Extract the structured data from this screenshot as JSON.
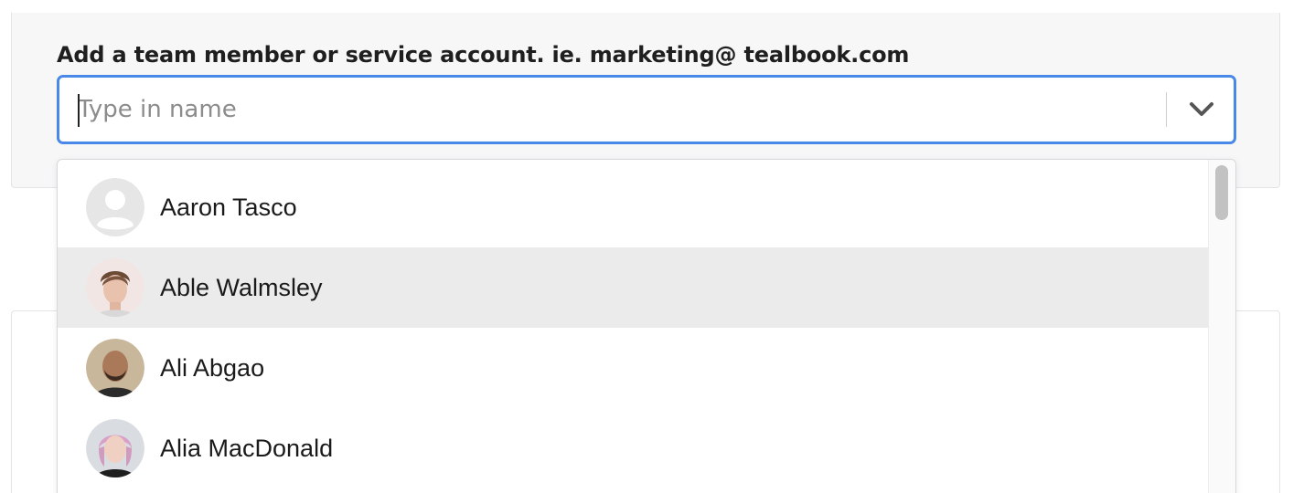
{
  "form": {
    "label": "Add a team member or service account. ie. marketing@ tealbook.com",
    "input_value": "",
    "input_placeholder": "Type in name"
  },
  "dropdown": {
    "toggle_icon": "chevron-down-icon",
    "highlighted_index": 1,
    "options": [
      {
        "name": "Aaron Tasco",
        "avatar": "default-user-icon"
      },
      {
        "name": "Able Walmsley",
        "avatar": "photo"
      },
      {
        "name": "Ali Abgao",
        "avatar": "photo"
      },
      {
        "name": "Alia MacDonald",
        "avatar": "photo"
      }
    ]
  },
  "colors": {
    "focus_border": "#4a88e8",
    "highlight_row": "#ebebeb",
    "panel_background": "#f7f7f8"
  }
}
